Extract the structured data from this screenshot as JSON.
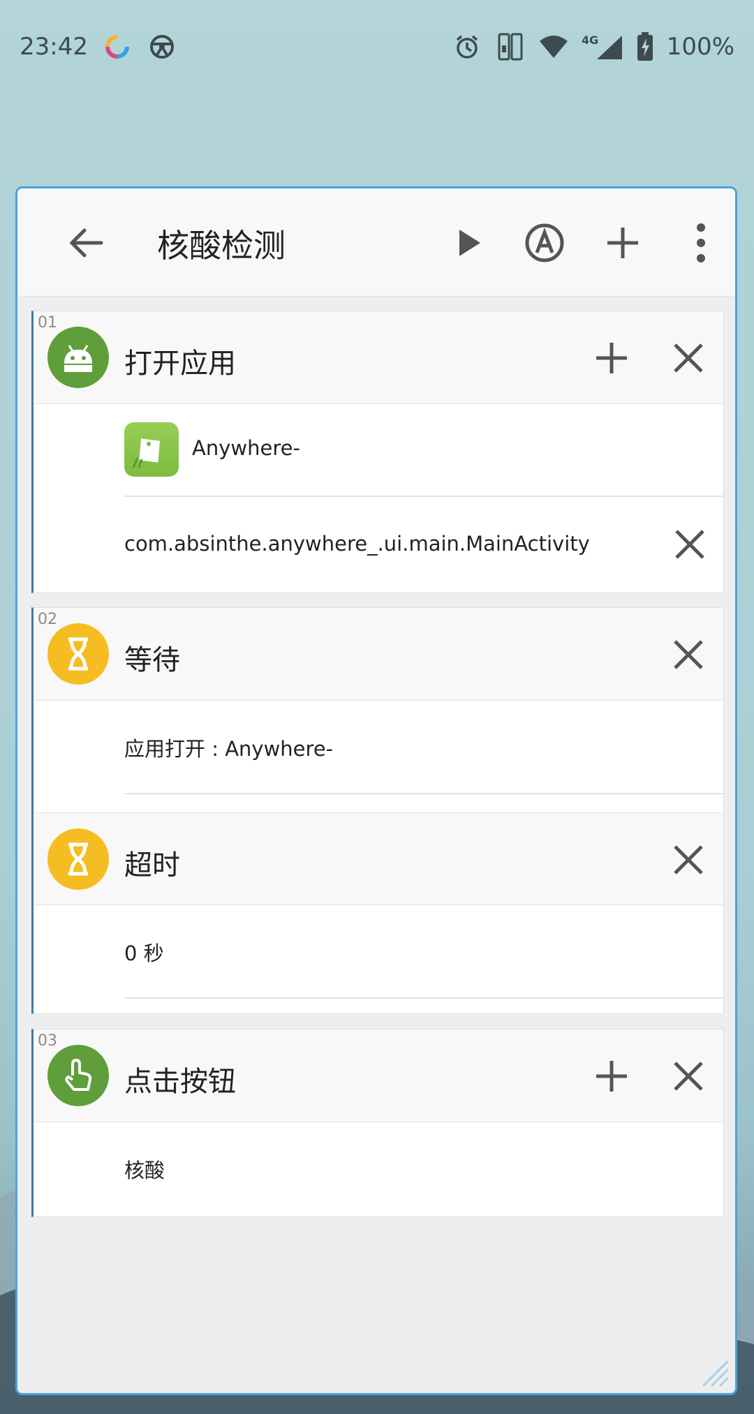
{
  "status_bar": {
    "time": "23:42",
    "network": "4G",
    "battery": "100%"
  },
  "window": {
    "title": "核酸检测"
  },
  "steps": [
    {
      "number": "01",
      "title": "打开应用",
      "icon": "android-icon",
      "app_name": "Anywhere-",
      "activity": "com.absinthe.anywhere_.ui.main.MainActivity"
    },
    {
      "number": "02",
      "title": "等待",
      "icon": "hourglass-icon",
      "condition": "应用打开 : Anywhere-",
      "timeout_title": "超时",
      "timeout_value": "0  秒"
    },
    {
      "number": "03",
      "title": "点击按钮",
      "icon": "tap-icon",
      "target": "核酸"
    }
  ],
  "colors": {
    "accent": "#4aa3df",
    "green": "#5f9e3a",
    "yellow": "#f6bd22"
  }
}
